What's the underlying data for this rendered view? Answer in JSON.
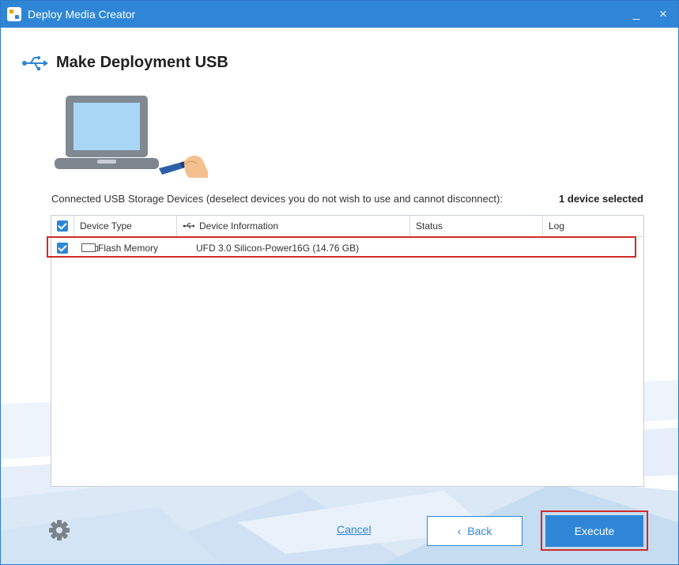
{
  "window": {
    "title": "Deploy Media Creator",
    "minimize_glyph": "_",
    "close_glyph": "×"
  },
  "heading": {
    "title": "Make Deployment USB",
    "icon": "usb-icon"
  },
  "devices": {
    "caption": "Connected USB Storage Devices (deselect devices you do not wish to use and cannot disconnect):",
    "selected_count": "1 device selected",
    "columns": [
      "Device Type",
      "Device Information",
      "Status",
      "Log"
    ],
    "rows": [
      {
        "checked": true,
        "device_type": "Flash Memory",
        "device_information": "UFD 3.0 Silicon-Power16G (14.76 GB)",
        "status": "",
        "log": ""
      }
    ]
  },
  "footer": {
    "cancel_label": "Cancel",
    "back_label": "Back",
    "back_glyph": "‹",
    "execute_label": "Execute",
    "settings_icon": "gear-icon"
  },
  "colors": {
    "accent": "#2f86d6",
    "highlight": "#d02b2b"
  }
}
